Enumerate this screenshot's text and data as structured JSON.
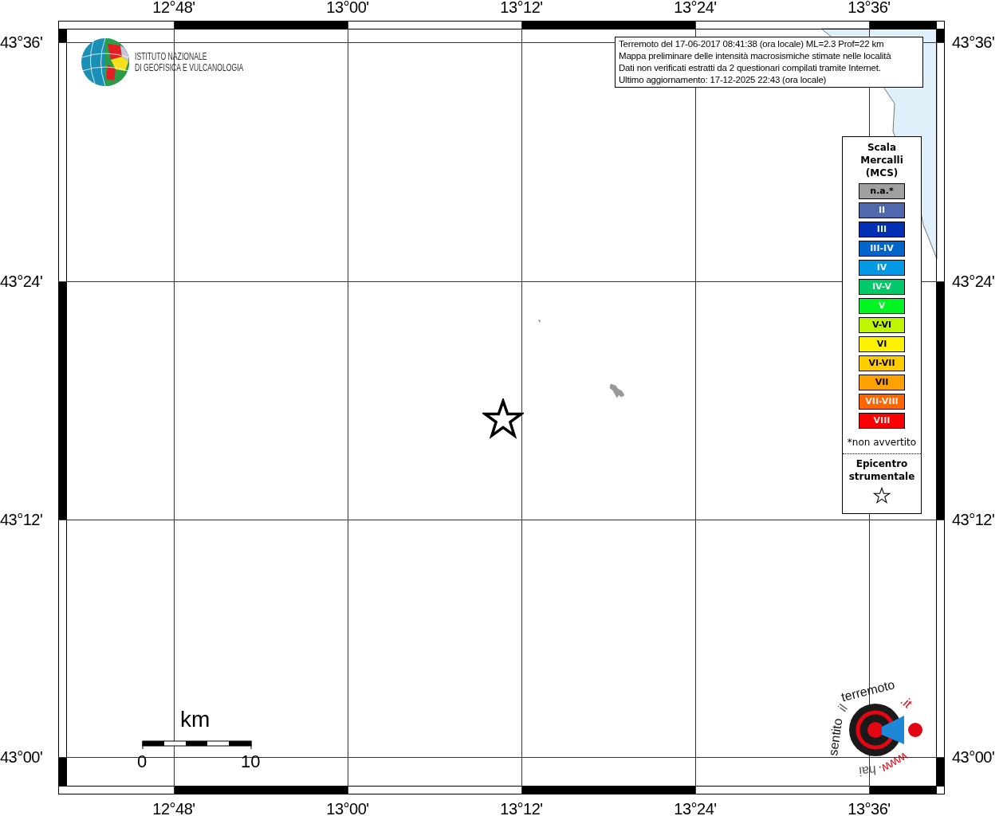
{
  "map": {
    "top_axis": [
      "12°48'",
      "13°00'",
      "13°12'",
      "13°24'",
      "13°36'"
    ],
    "bottom_axis": [
      "12°48'",
      "13°00'",
      "13°12'",
      "13°24'",
      "13°36'"
    ],
    "left_axis": [
      "43°36'",
      "43°24'",
      "43°12'",
      "43°00'"
    ],
    "right_axis": [
      "43°36'",
      "43°24'",
      "43°12'",
      "43°00'"
    ]
  },
  "info_box": {
    "lines": [
      "Terremoto del 17-06-2017 08:41:38 (ora locale) ML=2.3 Prof=22 km",
      "Mappa preliminare delle intensità macrosismiche stimate nelle località",
      "Dati non verificati estratti da 2 questionari compilati tramite Internet.",
      "Ultimo aggiornamento: 17-12-2025 22:43 (ora locale)"
    ]
  },
  "ingv_logo": {
    "lines": [
      "ISTITUTO NAZIONALE",
      "DI GEOFISICA E VULCANOLOGIA"
    ]
  },
  "legend": {
    "title_lines": [
      "Scala",
      "Mercalli",
      "(MCS)"
    ],
    "entries": [
      {
        "label": "n.a.*",
        "color": "#a0a0a0"
      },
      {
        "label": "II",
        "color": "#5068ae"
      },
      {
        "label": "III",
        "color": "#0030b4"
      },
      {
        "label": "III-IV",
        "color": "#0066cc"
      },
      {
        "label": "IV",
        "color": "#0099e6"
      },
      {
        "label": "IV-V",
        "color": "#00c96a"
      },
      {
        "label": "V",
        "color": "#00f522"
      },
      {
        "label": "V-VI",
        "color": "#c0f500"
      },
      {
        "label": "VI",
        "color": "#fff200"
      },
      {
        "label": "VI-VII",
        "color": "#ffcc00"
      },
      {
        "label": "VII",
        "color": "#ffa200"
      },
      {
        "label": "VII-VIII",
        "color": "#ff6600"
      },
      {
        "label": "VIII",
        "color": "#ff0000"
      }
    ],
    "footnote": "*non avvertito",
    "epicenter_label": "Epicentro strumentale"
  },
  "scale_bar": {
    "unit": "km",
    "start": "0",
    "end": "10"
  },
  "hsit_logo": {
    "parts": [
      {
        "text": "www.",
        "color": "#e30613"
      },
      {
        "text": "hai",
        "color": "#555555"
      },
      {
        "text": "sentito",
        "color": "#111111"
      },
      {
        "text": "il",
        "color": "#555555"
      },
      {
        "text": "terremoto",
        "color": "#111111"
      },
      {
        "text": ".it",
        "color": "#e30613"
      }
    ]
  }
}
